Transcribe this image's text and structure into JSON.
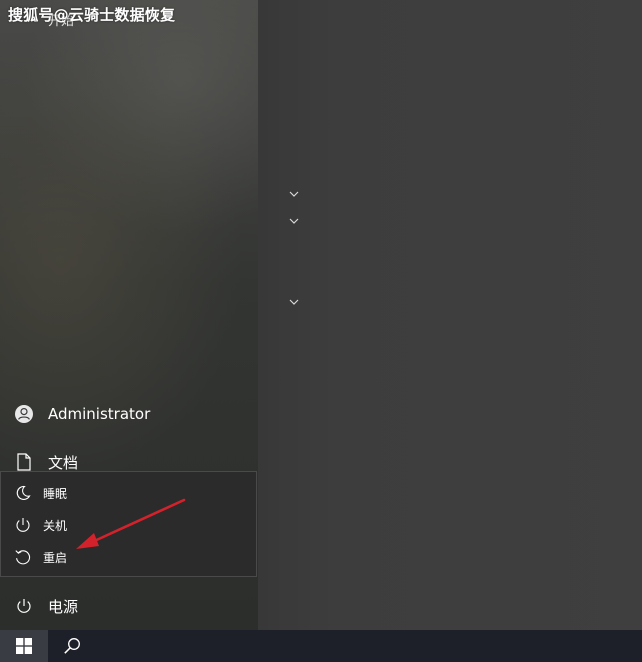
{
  "watermark": "搜狐号@云骑士数据恢复",
  "start_menu": {
    "header_partial": "开始",
    "user": {
      "icon": "user-avatar-icon",
      "name": "Administrator"
    },
    "items": [
      {
        "icon": "document-icon",
        "label": "文档"
      }
    ],
    "power": {
      "icon": "power-icon",
      "label": "电源"
    }
  },
  "power_flyout": {
    "items": [
      {
        "icon": "sleep-moon-icon",
        "label": "睡眠"
      },
      {
        "icon": "shutdown-icon",
        "label": "关机"
      },
      {
        "icon": "restart-icon",
        "label": "重启"
      }
    ]
  },
  "annotation": {
    "type": "red-arrow",
    "points_to": "重启",
    "color": "#d3222b"
  },
  "tiles_area": {
    "group_chevrons": [
      "chevron-down-icon",
      "chevron-down-icon",
      "chevron-down-icon"
    ]
  },
  "taskbar": {
    "start_icon": "windows-logo-icon",
    "search_icon": "search-icon"
  },
  "colors": {
    "taskbar": "#1d2028",
    "flyout": "#2b2b2b",
    "start_button_active": "#3a3c44",
    "arrow": "#d3222b"
  }
}
